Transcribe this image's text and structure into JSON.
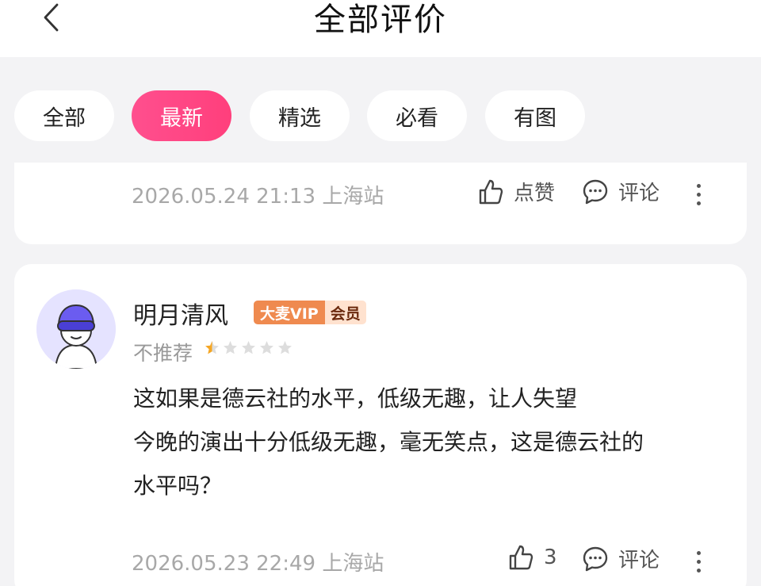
{
  "header": {
    "title": "全部评价"
  },
  "tabs": [
    {
      "label": "全部",
      "active": false
    },
    {
      "label": "最新",
      "active": true
    },
    {
      "label": "精选",
      "active": false
    },
    {
      "label": "必看",
      "active": false
    },
    {
      "label": "有图",
      "active": false
    }
  ],
  "reviews": [
    {
      "timestamp": "2026.05.24 21:13",
      "location": "上海站",
      "like_label": "点赞",
      "comment_label": "评论"
    },
    {
      "username": "明月清风",
      "badge_vip": "大麦VIP",
      "badge_member": "会员",
      "rating_text": "不推荐",
      "rating_stars": 0.5,
      "rating_max": 5,
      "text_lines": [
        "这如果是德云社的水平，低级无趣，让人失望",
        "今晚的演出十分低级无趣，毫无笑点，这是德云社的",
        "水平吗？"
      ],
      "timestamp": "2026.05.23 22:49",
      "location": "上海站",
      "like_count": "3",
      "comment_label": "评论"
    }
  ],
  "colors": {
    "accent": "#ff4584",
    "vip_orange": "#ef8a4f",
    "star_active": "#f5a623",
    "star_inactive": "#dddddd"
  }
}
